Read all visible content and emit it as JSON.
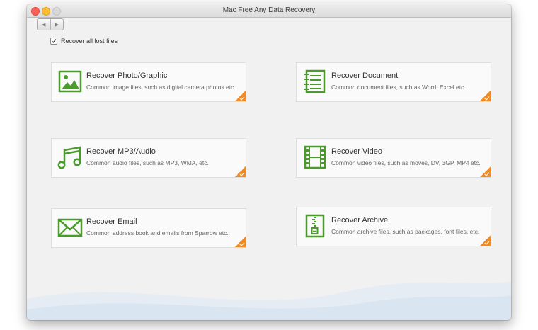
{
  "window": {
    "title": "Mac Free Any Data Recovery"
  },
  "nav": {
    "back_glyph": "◀",
    "forward_glyph": "▶"
  },
  "recover_all": {
    "label": "Recover all lost files",
    "checked": true
  },
  "colors": {
    "icon_green": "#4a9a2c",
    "accent_orange": "#f08a24"
  },
  "cards": [
    {
      "title": "Recover Photo/Graphic",
      "desc": "Common image files, such as digital camera photos etc.",
      "icon": "image-icon"
    },
    {
      "title": "Recover Document",
      "desc": "Common document files, such as Word, Excel etc.",
      "icon": "document-icon"
    },
    {
      "title": "Recover MP3/Audio",
      "desc": "Common audio files, such as MP3, WMA, etc.",
      "icon": "music-note-icon"
    },
    {
      "title": "Recover Video",
      "desc": "Common video files, such as moves, DV, 3GP, MP4 etc.",
      "icon": "film-icon"
    },
    {
      "title": "Recover Email",
      "desc": "Common address book and emails from Sparrow etc.",
      "icon": "envelope-icon"
    },
    {
      "title": "Recover Archive",
      "desc": "Common archive files, such as packages, font files, etc.",
      "icon": "zip-archive-icon"
    }
  ]
}
